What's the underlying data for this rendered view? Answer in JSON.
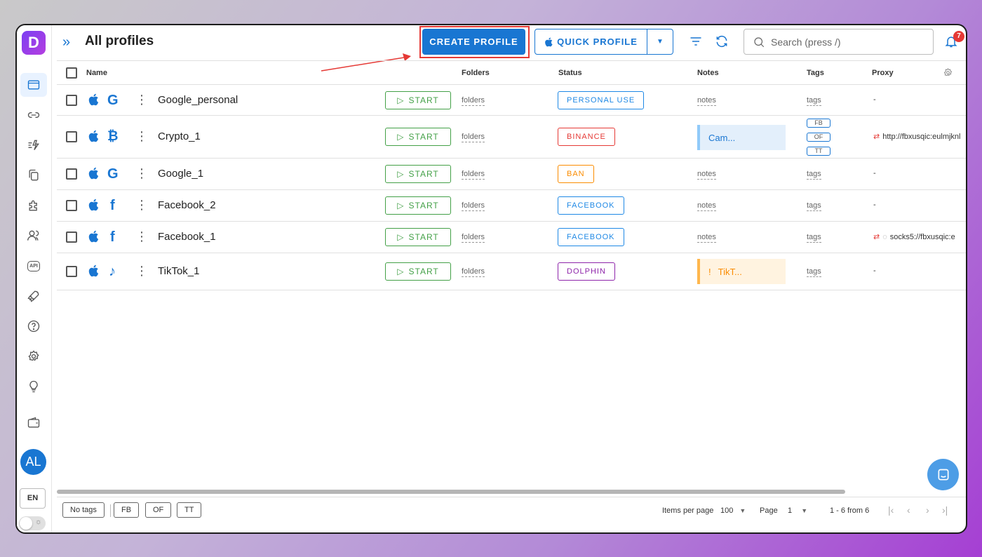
{
  "app": {
    "logo_letter": "D",
    "accent": "#1976d2",
    "brand": "#9c3fe6"
  },
  "header": {
    "title": "All profiles",
    "create_label": "CREATE PROFILE",
    "quick_label": "QUICK PROFILE",
    "search_placeholder": "Search (press /)",
    "notifications_count": "7"
  },
  "sidebar": {
    "items": [
      {
        "icon": "browser-window-icon",
        "active": true
      },
      {
        "icon": "link-icon"
      },
      {
        "icon": "automation-icon"
      },
      {
        "icon": "copy-icon"
      },
      {
        "icon": "extensions-icon"
      },
      {
        "icon": "users-icon"
      },
      {
        "icon": "api-icon"
      },
      {
        "icon": "rocket-icon"
      },
      {
        "icon": "help-icon"
      },
      {
        "icon": "settings-icon"
      },
      {
        "icon": "lightbulb-icon"
      },
      {
        "icon": "wallet-icon"
      }
    ],
    "avatar": "AL",
    "lang": "EN",
    "api_label": "API"
  },
  "table": {
    "columns": {
      "name": "Name",
      "folders": "Folders",
      "status": "Status",
      "notes": "Notes",
      "tags": "Tags",
      "proxy": "Proxy"
    },
    "start_label": "START",
    "rows": [
      {
        "name": "Google_personal",
        "os": "apple-icon",
        "service": "google-icon",
        "service_glyph": "G",
        "folders": "folders",
        "status": "PERSONAL USE",
        "status_color": "#1e88e5",
        "notes": "notes",
        "tags": "tags",
        "proxy": "-"
      },
      {
        "name": "Crypto_1",
        "os": "apple-icon",
        "service": "bitcoin-icon",
        "service_glyph": "₿",
        "folders": "folders",
        "status": "BINANCE",
        "status_color": "#e53935",
        "notes": "Cam...",
        "note_color": "#90caf9",
        "tags_list": [
          "FB",
          "OF",
          "TT"
        ],
        "proxy": "http://fbxusqic:eulmjknl"
      },
      {
        "name": "Google_1",
        "os": "apple-icon",
        "service": "google-icon",
        "service_glyph": "G",
        "folders": "folders",
        "status": "BAN",
        "status_color": "#fb8c00",
        "notes": "notes",
        "tags": "tags",
        "proxy": "-"
      },
      {
        "name": "Facebook_2",
        "os": "apple-icon",
        "service": "facebook-icon",
        "service_glyph": "f",
        "folders": "folders",
        "status": "FACEBOOK",
        "status_color": "#1e88e5",
        "notes": "notes",
        "tags": "tags",
        "proxy": "-"
      },
      {
        "name": "Facebook_1",
        "os": "apple-icon",
        "service": "facebook-icon",
        "service_glyph": "f",
        "folders": "folders",
        "status": "FACEBOOK",
        "status_color": "#1e88e5",
        "notes": "notes",
        "tags": "tags",
        "proxy": "socks5://fbxusqic:e"
      },
      {
        "name": "TikTok_1",
        "os": "apple-icon",
        "service": "tiktok-icon",
        "service_glyph": "♪",
        "folders": "folders",
        "status": "DOLPHIN",
        "status_color": "#8e24aa",
        "notes": "TikT...",
        "note_mark": "!",
        "note_color": "#ffb74d",
        "tags": "tags",
        "proxy": "-"
      }
    ]
  },
  "footer": {
    "tag_filters": [
      "No tags",
      "FB",
      "OF",
      "TT"
    ],
    "items_per_page_label": "Items per page",
    "items_per_page": "100",
    "page_label": "Page",
    "page": "1",
    "range": "1 - 6 from 6"
  }
}
